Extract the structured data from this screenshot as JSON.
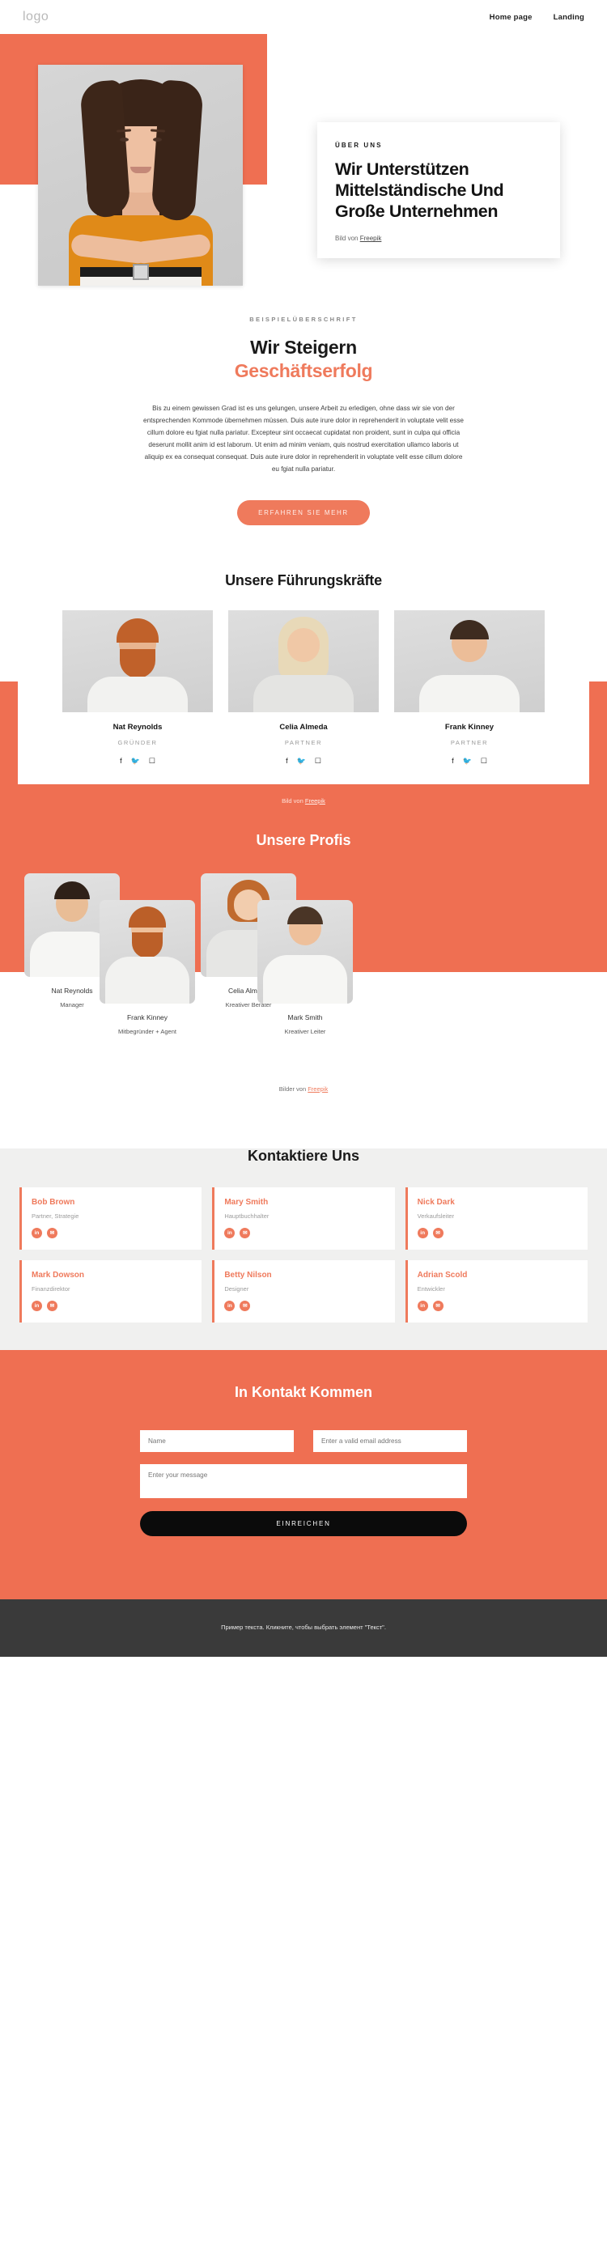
{
  "header": {
    "logo": "logo",
    "nav": [
      {
        "label": "Home page"
      },
      {
        "label": "Landing"
      }
    ]
  },
  "hero": {
    "eyebrow": "ÜBER UNS",
    "title": "Wir Unterstützen Mittelständische Und Große Unternehmen",
    "credit_prefix": "Bild von ",
    "credit_link": "Freepik"
  },
  "success": {
    "eyebrow": "BEISPIELÜBERSCHRIFT",
    "title_line1": "Wir Steigern",
    "title_line2": "Geschäftserfolg",
    "paragraph": "Bis zu einem gewissen Grad ist es uns gelungen, unsere Arbeit zu erledigen, ohne dass wir sie von der entsprechenden Kommode übernehmen müssen. Duis aute irure dolor in reprehenderit in voluptate velit esse cillum dolore eu fgiat nulla pariatur. Excepteur sint occaecat cupidatat non proident, sunt in culpa qui officia deserunt mollit anim id est laborum. Ut enim ad minim veniam, quis nostrud exercitation ullamco laboris ut aliquip ex ea consequat consequat. Duis aute irure dolor in reprehenderit in voluptate velit esse cillum dolore eu fgiat nulla pariatur.",
    "cta": "ERFAHREN SIE MEHR"
  },
  "leadership": {
    "title": "Unsere Führungskräfte",
    "members": [
      {
        "name": "Nat Reynolds",
        "role": "GRÜNDER"
      },
      {
        "name": "Celia Almeda",
        "role": "PARTNER"
      },
      {
        "name": "Frank Kinney",
        "role": "PARTNER"
      }
    ],
    "social_icons": [
      "facebook-icon",
      "twitter-icon",
      "instagram-icon"
    ],
    "credit_prefix": "Bild von ",
    "credit_link": "Freepik"
  },
  "profis": {
    "title": "Unsere Profis",
    "members": [
      {
        "name": "Nat Reynolds",
        "role": "Manager"
      },
      {
        "name": "Frank Kinney",
        "role": "Mitbegründer + Agent"
      },
      {
        "name": "Celia Almeda",
        "role": "Kreativer Berater"
      },
      {
        "name": "Mark Smith",
        "role": "Kreativer Leiter"
      }
    ],
    "credit_prefix": "Bilder von ",
    "credit_link": "Freepik"
  },
  "kontakt": {
    "title": "Kontaktiere Uns",
    "cards": [
      {
        "name": "Bob Brown",
        "role": "Partner, Strategie"
      },
      {
        "name": "Mary Smith",
        "role": "Hauptbuchhalter"
      },
      {
        "name": "Nick Dark",
        "role": "Verkaufsleiter"
      },
      {
        "name": "Mark Dowson",
        "role": "Finanzdirektor"
      },
      {
        "name": "Betty Nilson",
        "role": "Designer"
      },
      {
        "name": "Adrian Scold",
        "role": "Entwickler"
      }
    ],
    "icons": {
      "linkedin": "in",
      "email": "✉"
    }
  },
  "form": {
    "title": "In Kontakt Kommen",
    "name_placeholder": "Name",
    "email_placeholder": "Enter a valid email address",
    "message_placeholder": "Enter your message",
    "submit": "EINREICHEN",
    "name_value": "",
    "email_value": "",
    "message_value": ""
  },
  "footer": {
    "text": "Пример текста. Кликните, чтобы выбрать элемент \"Текст\"."
  },
  "colors": {
    "accent": "#ef6f52",
    "accent_light": "#ef7a5c",
    "dark": "#3a3a3a",
    "grey_bg": "#f0f0ef"
  }
}
